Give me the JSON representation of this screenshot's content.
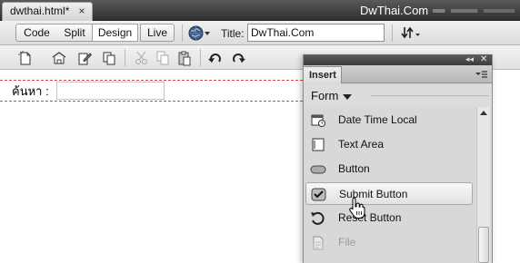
{
  "document_tab": {
    "title": "dwthai.html*",
    "close_glyph": "×"
  },
  "window": {
    "site_title": "DwThai.Com"
  },
  "view_toolbar": {
    "code_label": "Code",
    "split_label": "Split",
    "design_label": "Design",
    "live_label": "Live",
    "title_label": "Title:",
    "title_value": "DwThai.Com",
    "icons": [
      "globe-icon",
      "file-sync-icon"
    ]
  },
  "edit_toolbar": {
    "icons": [
      "new-file-icon",
      "open-file-icon",
      "edit-file-icon",
      "copy-file-icon",
      "cut-icon",
      "copy-icon",
      "paste-icon",
      "undo-icon",
      "redo-icon"
    ]
  },
  "canvas": {
    "search_label": "ค้นหา :"
  },
  "insert_panel": {
    "title": "Insert",
    "category": "Form",
    "items": [
      {
        "label": "Date Time Local",
        "icon": "calendar-clock-icon"
      },
      {
        "label": "Text Area",
        "icon": "text-area-icon"
      },
      {
        "label": "Button",
        "icon": "button-icon"
      },
      {
        "label": "Submit Button",
        "icon": "checkbox-checked-icon"
      },
      {
        "label": "Reset Button",
        "icon": "reset-icon"
      },
      {
        "label": "File",
        "icon": "file-icon"
      }
    ]
  },
  "colors": {
    "titlebar": "#3b3b3b",
    "panel": "#d8d8d8",
    "guide": "#dd4444"
  }
}
